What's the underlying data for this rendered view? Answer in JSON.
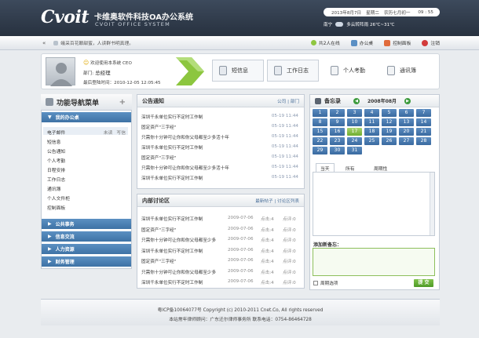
{
  "header": {
    "logo": "Cvoit",
    "title_cn": "卡维奥软件科技OA办公系统",
    "title_en": "CVOIT OFFICE SYSTEM",
    "date": "2013年8月7日",
    "weekday": "星期二",
    "lunar": "农历七月初一",
    "time": "09 : 55",
    "city": "南宁",
    "weather": "多云转阵雨 26℃~31℃"
  },
  "toolbar": {
    "notice": "蛾采百花酿甜蜜，人读群书明真理。",
    "online": "共2人在线",
    "office": "办公桌",
    "control": "控制面板",
    "logout": "注销"
  },
  "user": {
    "welcome": "欢迎使用本系统 CEO",
    "dept_label": "部门:",
    "dept_value": "总经理",
    "last_login": "最后登陆时间：2010-12-05 12:05:45"
  },
  "quick": {
    "messages": "短信息",
    "worklog": "工作日志",
    "attendance": "个人考勤",
    "contacts": "通讯簿"
  },
  "sidebar": {
    "title": "功能导航菜单",
    "plus": "+",
    "my_office": "我的办公桌",
    "items": [
      {
        "label": "电子邮件",
        "extra1": "未读",
        "extra2": "写信"
      },
      {
        "label": "短信息"
      },
      {
        "label": "公告通知"
      },
      {
        "label": "个人考勤"
      },
      {
        "label": "日程安排"
      },
      {
        "label": "工作日志"
      },
      {
        "label": "通讯簿"
      },
      {
        "label": "个人文件柜"
      },
      {
        "label": "控制面板"
      }
    ],
    "sections": [
      "公共事务",
      "信息交流",
      "人力资源",
      "财务管理"
    ]
  },
  "announcements": {
    "title": "公告通知",
    "links": "公司 | 部门",
    "rows": [
      {
        "text": "深圳千永单位实行不定时工作制",
        "date": "05-19 11:44"
      },
      {
        "text": "固定资产\"三字经\"",
        "date": "05-19 11:44"
      },
      {
        "text": "只需你十分钟可让你和你父母都至少多活十年",
        "date": "05-19 11:44"
      },
      {
        "text": "深圳千永单位实行不定时工作制",
        "date": "05-19 11:44"
      },
      {
        "text": "固定资产\"三字经\"",
        "date": "05-19 11:44"
      },
      {
        "text": "只需你十分钟可让你和你父母都至少多活十年",
        "date": "05-19 11:44"
      },
      {
        "text": "深圳千永单位实行不定时工作制",
        "date": "05-19 11:44"
      }
    ]
  },
  "discussion": {
    "title": "内部讨论区",
    "links": "最新帖子 | 讨论区列表",
    "rows": [
      {
        "text": "深圳千永单位实行不定时工作制",
        "date": "2009-07-06",
        "clicks": "点击:4",
        "replies": "点评:0"
      },
      {
        "text": "固定资产\"三字经\"",
        "date": "2009-07-06",
        "clicks": "点击:4",
        "replies": "点评:0"
      },
      {
        "text": "只需你十分钟可让你和你父母都至少多",
        "date": "2009-07-06",
        "clicks": "点击:4",
        "replies": "点评:0"
      },
      {
        "text": "深圳千永单位实行不定时工作制",
        "date": "2009-07-06",
        "clicks": "点击:4",
        "replies": "点评:0"
      },
      {
        "text": "固定资产\"三字经\"",
        "date": "2009-07-06",
        "clicks": "点击:4",
        "replies": "点评:0"
      },
      {
        "text": "只需你十分钟可让你和你父母都至少多",
        "date": "2009-07-06",
        "clicks": "点击:4",
        "replies": "点评:0"
      },
      {
        "text": "深圳千永单位实行不定时工作制",
        "date": "2009-07-06",
        "clicks": "点击:4",
        "replies": "点评:0"
      }
    ]
  },
  "memo": {
    "title": "备忘录",
    "month": "2008年08月",
    "days": [
      "1",
      "2",
      "3",
      "4",
      "5",
      "6",
      "7",
      "8",
      "9",
      "10",
      "11",
      "12",
      "13",
      "14",
      "15",
      "16",
      "17",
      "18",
      "19",
      "20",
      "21",
      "22",
      "23",
      "24",
      "25",
      "26",
      "27",
      "28",
      "29",
      "30",
      "31"
    ],
    "today": "17",
    "tabs": [
      "当天",
      "所有",
      "周期性"
    ],
    "new_label": "添加新备忘：",
    "cycle_label": "周期选项",
    "submit": "提 交"
  },
  "footer": {
    "line1": "粤ICP备10064077号   Copyright (c) 2010-2011 Cnet.Co, All rights reserved",
    "line2": "本站常年律师顾问：广东迁尔律师事务所 联系电话：0754-86464728"
  },
  "colors": {
    "header": "#2f3a49",
    "nav_blue": "#4a7eb3",
    "accent_green": "#6fae2f"
  }
}
